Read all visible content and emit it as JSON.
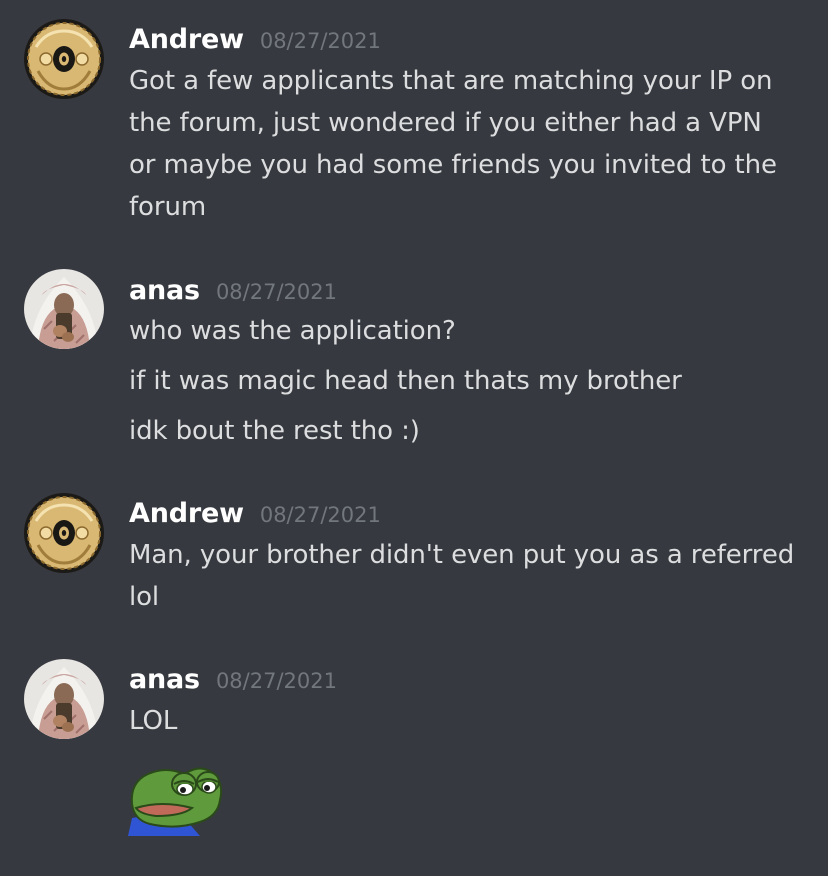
{
  "messages": [
    {
      "author": "Andrew",
      "timestamp": "08/27/2021",
      "avatar_icon": "gold-ornament-avatar",
      "lines": [
        "Got a few applicants that are matching your IP on",
        "the forum, just wondered if you either had a VPN",
        "or maybe you had some friends you invited to the",
        "forum"
      ]
    },
    {
      "author": "anas",
      "timestamp": "08/27/2021",
      "avatar_icon": "person-keffiyeh-avatar",
      "lines": [
        "who was the application?",
        "if it was magic head then thats my brother",
        "idk bout the rest tho :)"
      ]
    },
    {
      "author": "Andrew",
      "timestamp": "08/27/2021",
      "avatar_icon": "gold-ornament-avatar",
      "lines": [
        "Man, your brother didn't even put you as a referred",
        "lol"
      ]
    },
    {
      "author": "anas",
      "timestamp": "08/27/2021",
      "avatar_icon": "person-keffiyeh-avatar",
      "lines": [
        "LOL"
      ],
      "emoji": "sad-frog-emoji"
    }
  ],
  "colors": {
    "background": "#36393f",
    "username": "#ffffff",
    "timestamp": "#72767d",
    "text": "#dcddde"
  }
}
